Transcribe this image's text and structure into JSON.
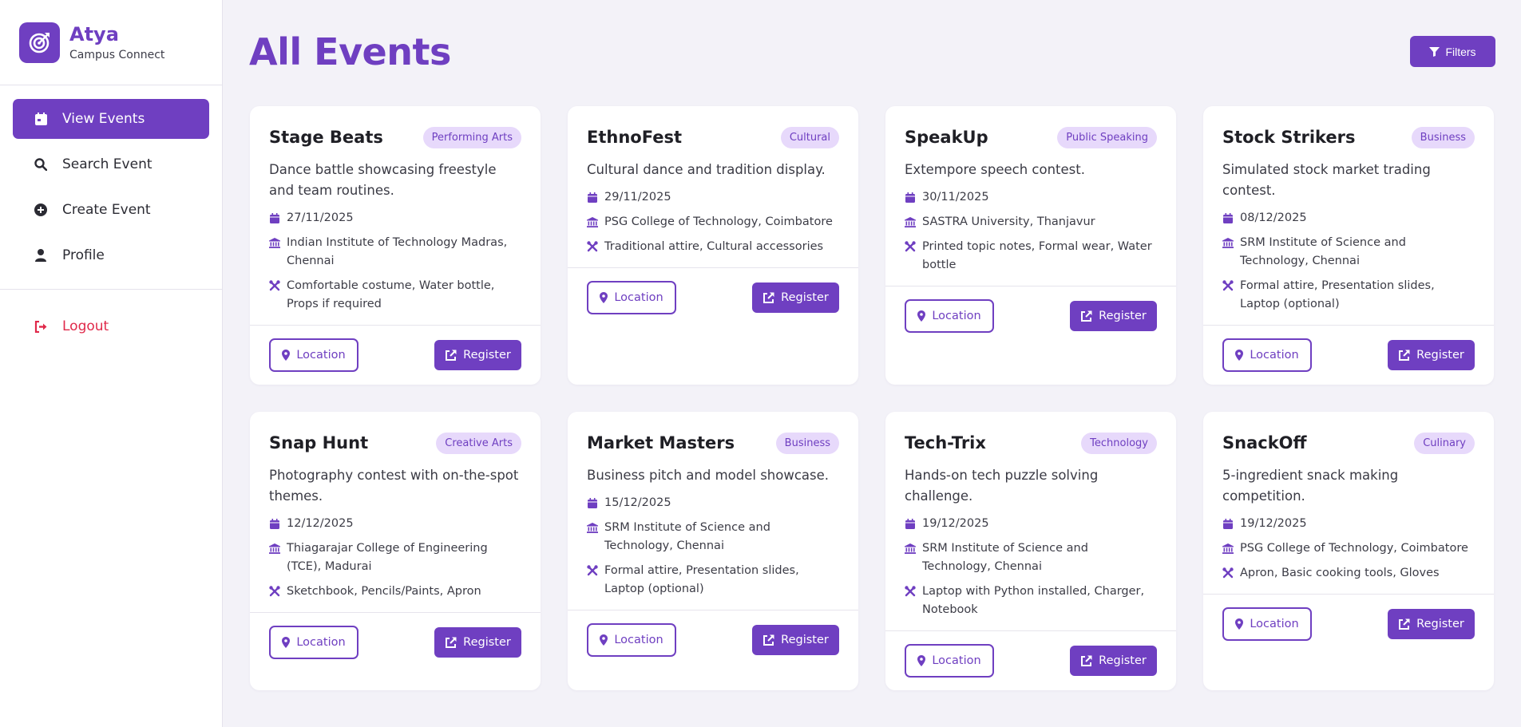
{
  "brand": {
    "name": "Atya",
    "subtitle": "Campus Connect"
  },
  "nav": [
    {
      "label": "View Events",
      "icon": "calendar-icon",
      "active": true
    },
    {
      "label": "Search Event",
      "icon": "search-icon",
      "active": false
    },
    {
      "label": "Create Event",
      "icon": "plus-circle-icon",
      "active": false
    },
    {
      "label": "Profile",
      "icon": "user-icon",
      "active": false
    }
  ],
  "logout_label": "Logout",
  "page_title": "All Events",
  "filters_label": "Filters",
  "buttons": {
    "location": "Location",
    "register": "Register"
  },
  "colors": {
    "accent": "#6f3fc1",
    "tag_bg": "#e7d9fb",
    "logout": "#e0294a",
    "background": "#f3f2f8"
  },
  "events": [
    {
      "title": "Stage Beats",
      "category": "Performing Arts",
      "description": "Dance battle showcasing freestyle and team routines.",
      "date": "27/11/2025",
      "venue": "Indian Institute of Technology Madras, Chennai",
      "requirements": "Comfortable costume, Water bottle, Props if required"
    },
    {
      "title": "EthnoFest",
      "category": "Cultural",
      "description": "Cultural dance and tradition display.",
      "date": "29/11/2025",
      "venue": "PSG College of Technology, Coimbatore",
      "requirements": "Traditional attire, Cultural accessories"
    },
    {
      "title": "SpeakUp",
      "category": "Public Speaking",
      "description": "Extempore speech contest.",
      "date": "30/11/2025",
      "venue": "SASTRA University, Thanjavur",
      "requirements": "Printed topic notes, Formal wear, Water bottle"
    },
    {
      "title": "Stock Strikers",
      "category": "Business",
      "description": "Simulated stock market trading contest.",
      "date": "08/12/2025",
      "venue": "SRM Institute of Science and Technology, Chennai",
      "requirements": "Formal attire, Presentation slides, Laptop (optional)"
    },
    {
      "title": "Snap Hunt",
      "category": "Creative Arts",
      "description": "Photography contest with on-the-spot themes.",
      "date": "12/12/2025",
      "venue": "Thiagarajar College of Engineering (TCE), Madurai",
      "requirements": "Sketchbook, Pencils/Paints, Apron"
    },
    {
      "title": "Market Masters",
      "category": "Business",
      "description": "Business pitch and model showcase.",
      "date": "15/12/2025",
      "venue": "SRM Institute of Science and Technology, Chennai",
      "requirements": "Formal attire, Presentation slides, Laptop (optional)"
    },
    {
      "title": "Tech-Trix",
      "category": "Technology",
      "description": "Hands-on tech puzzle solving challenge.",
      "date": "19/12/2025",
      "venue": "SRM Institute of Science and Technology, Chennai",
      "requirements": "Laptop with Python installed, Charger, Notebook"
    },
    {
      "title": "SnackOff",
      "category": "Culinary",
      "description": "5-ingredient snack making competition.",
      "date": "19/12/2025",
      "venue": "PSG College of Technology, Coimbatore",
      "requirements": "Apron, Basic cooking tools, Gloves"
    }
  ]
}
